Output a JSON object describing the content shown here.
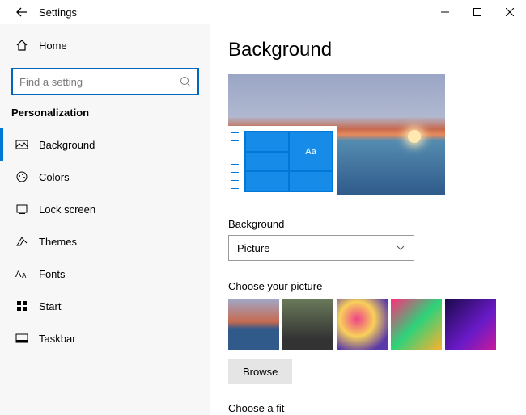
{
  "titlebar": {
    "app_title": "Settings"
  },
  "home_label": "Home",
  "search": {
    "placeholder": "Find a setting"
  },
  "section_title": "Personalization",
  "nav": [
    {
      "label": "Background",
      "active": true
    },
    {
      "label": "Colors"
    },
    {
      "label": "Lock screen"
    },
    {
      "label": "Themes"
    },
    {
      "label": "Fonts"
    },
    {
      "label": "Start"
    },
    {
      "label": "Taskbar"
    }
  ],
  "page": {
    "heading": "Background",
    "preview_tile_text": "Aa",
    "bg_label": "Background",
    "bg_selected": "Picture",
    "choose_picture_label": "Choose your picture",
    "browse_label": "Browse",
    "choose_fit_label": "Choose a fit"
  }
}
